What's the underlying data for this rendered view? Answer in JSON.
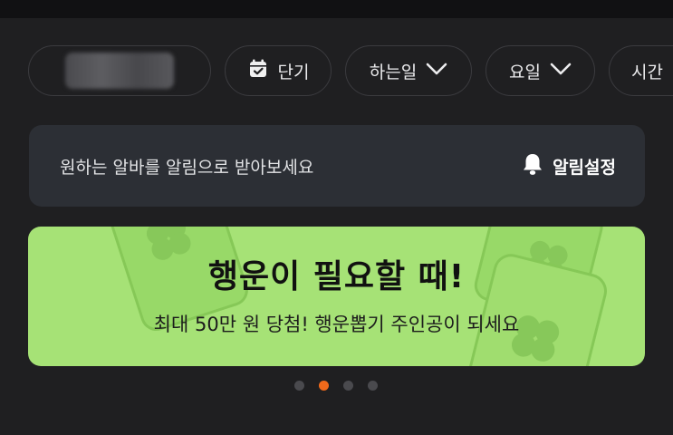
{
  "filters": {
    "short_term_label": "단기",
    "work_label": "하는일",
    "day_label": "요일",
    "time_label": "시간"
  },
  "alert": {
    "message": "원하는 알바를 알림으로 받아보세요",
    "button_label": "알림설정"
  },
  "banner": {
    "title": "행운이 필요할 때!",
    "subtitle": "최대 50만 원 당첨! 행운뽑기 주인공이 되세요"
  },
  "carousel": {
    "page_count": 4,
    "active_index": 1
  },
  "colors": {
    "accent": "#f26a1b",
    "banner_bg": "#a6e276",
    "card_bg": "#2c2f35"
  }
}
